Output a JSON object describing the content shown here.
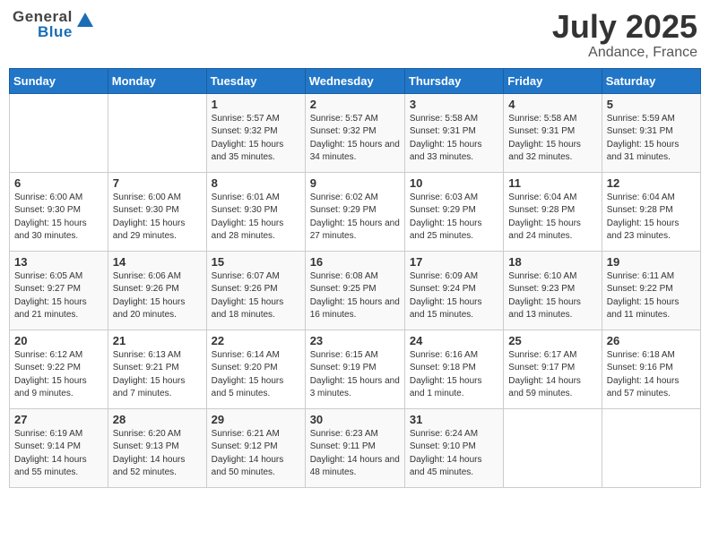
{
  "header": {
    "logo_general": "General",
    "logo_blue": "Blue",
    "month": "July 2025",
    "location": "Andance, France"
  },
  "weekdays": [
    "Sunday",
    "Monday",
    "Tuesday",
    "Wednesday",
    "Thursday",
    "Friday",
    "Saturday"
  ],
  "weeks": [
    [
      {
        "day": "",
        "info": ""
      },
      {
        "day": "",
        "info": ""
      },
      {
        "day": "1",
        "info": "Sunrise: 5:57 AM\nSunset: 9:32 PM\nDaylight: 15 hours and 35 minutes."
      },
      {
        "day": "2",
        "info": "Sunrise: 5:57 AM\nSunset: 9:32 PM\nDaylight: 15 hours and 34 minutes."
      },
      {
        "day": "3",
        "info": "Sunrise: 5:58 AM\nSunset: 9:31 PM\nDaylight: 15 hours and 33 minutes."
      },
      {
        "day": "4",
        "info": "Sunrise: 5:58 AM\nSunset: 9:31 PM\nDaylight: 15 hours and 32 minutes."
      },
      {
        "day": "5",
        "info": "Sunrise: 5:59 AM\nSunset: 9:31 PM\nDaylight: 15 hours and 31 minutes."
      }
    ],
    [
      {
        "day": "6",
        "info": "Sunrise: 6:00 AM\nSunset: 9:30 PM\nDaylight: 15 hours and 30 minutes."
      },
      {
        "day": "7",
        "info": "Sunrise: 6:00 AM\nSunset: 9:30 PM\nDaylight: 15 hours and 29 minutes."
      },
      {
        "day": "8",
        "info": "Sunrise: 6:01 AM\nSunset: 9:30 PM\nDaylight: 15 hours and 28 minutes."
      },
      {
        "day": "9",
        "info": "Sunrise: 6:02 AM\nSunset: 9:29 PM\nDaylight: 15 hours and 27 minutes."
      },
      {
        "day": "10",
        "info": "Sunrise: 6:03 AM\nSunset: 9:29 PM\nDaylight: 15 hours and 25 minutes."
      },
      {
        "day": "11",
        "info": "Sunrise: 6:04 AM\nSunset: 9:28 PM\nDaylight: 15 hours and 24 minutes."
      },
      {
        "day": "12",
        "info": "Sunrise: 6:04 AM\nSunset: 9:28 PM\nDaylight: 15 hours and 23 minutes."
      }
    ],
    [
      {
        "day": "13",
        "info": "Sunrise: 6:05 AM\nSunset: 9:27 PM\nDaylight: 15 hours and 21 minutes."
      },
      {
        "day": "14",
        "info": "Sunrise: 6:06 AM\nSunset: 9:26 PM\nDaylight: 15 hours and 20 minutes."
      },
      {
        "day": "15",
        "info": "Sunrise: 6:07 AM\nSunset: 9:26 PM\nDaylight: 15 hours and 18 minutes."
      },
      {
        "day": "16",
        "info": "Sunrise: 6:08 AM\nSunset: 9:25 PM\nDaylight: 15 hours and 16 minutes."
      },
      {
        "day": "17",
        "info": "Sunrise: 6:09 AM\nSunset: 9:24 PM\nDaylight: 15 hours and 15 minutes."
      },
      {
        "day": "18",
        "info": "Sunrise: 6:10 AM\nSunset: 9:23 PM\nDaylight: 15 hours and 13 minutes."
      },
      {
        "day": "19",
        "info": "Sunrise: 6:11 AM\nSunset: 9:22 PM\nDaylight: 15 hours and 11 minutes."
      }
    ],
    [
      {
        "day": "20",
        "info": "Sunrise: 6:12 AM\nSunset: 9:22 PM\nDaylight: 15 hours and 9 minutes."
      },
      {
        "day": "21",
        "info": "Sunrise: 6:13 AM\nSunset: 9:21 PM\nDaylight: 15 hours and 7 minutes."
      },
      {
        "day": "22",
        "info": "Sunrise: 6:14 AM\nSunset: 9:20 PM\nDaylight: 15 hours and 5 minutes."
      },
      {
        "day": "23",
        "info": "Sunrise: 6:15 AM\nSunset: 9:19 PM\nDaylight: 15 hours and 3 minutes."
      },
      {
        "day": "24",
        "info": "Sunrise: 6:16 AM\nSunset: 9:18 PM\nDaylight: 15 hours and 1 minute."
      },
      {
        "day": "25",
        "info": "Sunrise: 6:17 AM\nSunset: 9:17 PM\nDaylight: 14 hours and 59 minutes."
      },
      {
        "day": "26",
        "info": "Sunrise: 6:18 AM\nSunset: 9:16 PM\nDaylight: 14 hours and 57 minutes."
      }
    ],
    [
      {
        "day": "27",
        "info": "Sunrise: 6:19 AM\nSunset: 9:14 PM\nDaylight: 14 hours and 55 minutes."
      },
      {
        "day": "28",
        "info": "Sunrise: 6:20 AM\nSunset: 9:13 PM\nDaylight: 14 hours and 52 minutes."
      },
      {
        "day": "29",
        "info": "Sunrise: 6:21 AM\nSunset: 9:12 PM\nDaylight: 14 hours and 50 minutes."
      },
      {
        "day": "30",
        "info": "Sunrise: 6:23 AM\nSunset: 9:11 PM\nDaylight: 14 hours and 48 minutes."
      },
      {
        "day": "31",
        "info": "Sunrise: 6:24 AM\nSunset: 9:10 PM\nDaylight: 14 hours and 45 minutes."
      },
      {
        "day": "",
        "info": ""
      },
      {
        "day": "",
        "info": ""
      }
    ]
  ]
}
